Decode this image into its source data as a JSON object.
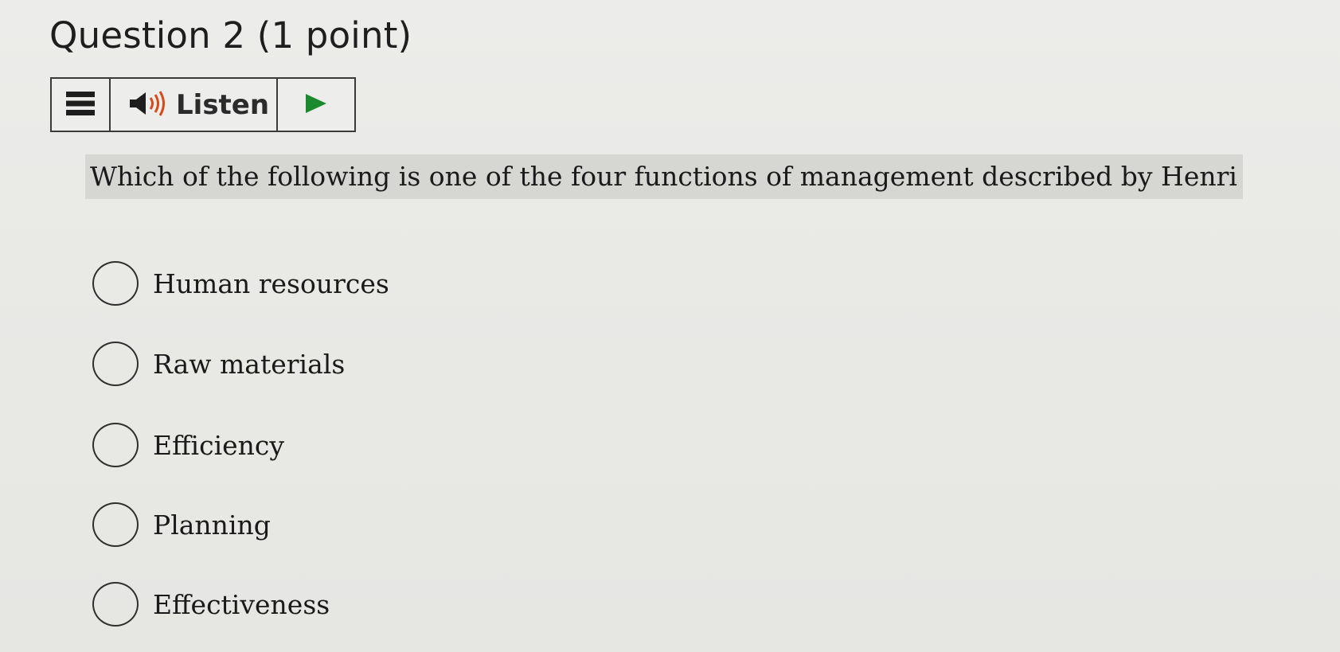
{
  "question": {
    "title": "Question 2 (1 point)",
    "text": "Which of the following is one of the four functions of management described by Henri Fayol?"
  },
  "listen_bar": {
    "menu_icon": "hamburger-menu-icon",
    "speaker_icon": "speaker-icon",
    "listen_label": "Listen",
    "play_icon": "play-icon",
    "accent_color": "#1b8a2e"
  },
  "options": [
    {
      "label": "Human resources",
      "selected": false
    },
    {
      "label": "Raw materials",
      "selected": false
    },
    {
      "label": "Efficiency",
      "selected": false
    },
    {
      "label": "Planning",
      "selected": false
    },
    {
      "label": "Effectiveness",
      "selected": false
    }
  ]
}
